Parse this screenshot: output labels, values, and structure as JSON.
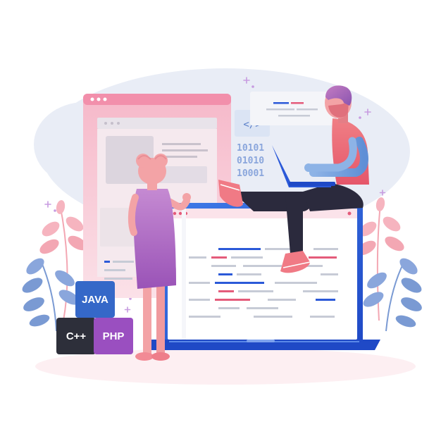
{
  "code_tag": "</>",
  "binary_lines": [
    "10101",
    "01010",
    "10001"
  ],
  "badges": {
    "java": "JAVA",
    "cpp": "C++",
    "php": "PHP"
  },
  "colors": {
    "pink_window": "#f4a3b9",
    "blue_frame": "#2b59d8",
    "java_badge": "#3568c8",
    "cpp_badge": "#2d2f3a",
    "php_badge": "#9a4fc0",
    "woman_dress": "#b767c9",
    "man_shirt": "#f06a72",
    "skin": "#f3a3a6",
    "man_hair": "#b56ab6",
    "background_blob": "#e9edf6",
    "leaf_blue": "#7a9ad3",
    "leaf_pink": "#f3a7b3"
  }
}
